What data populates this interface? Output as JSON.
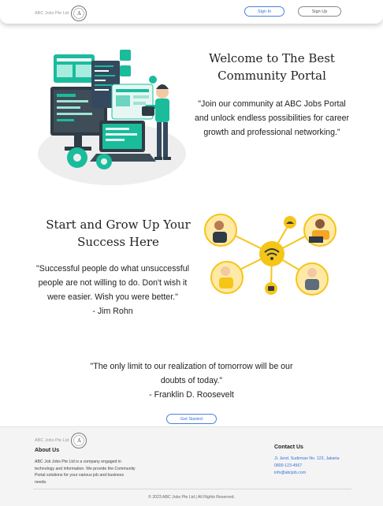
{
  "header": {
    "brand_name": "ABC Jobs Pte Ltd",
    "logo_letter": "A",
    "signin_label": "Sign In",
    "signup_label": "Sign Up"
  },
  "hero": {
    "title": "Welcome to The Best Community Portal",
    "quote": "\"Join our community at ABC Jobs Portal and unlock endless possibilities for career growth and professional networking.\""
  },
  "grow": {
    "title": "Start and Grow Up Your Success Here",
    "quote": "\"Successful people do what unsuccessful people are not willing to do. Don't wish it were easier. Wish you were better.\"",
    "author": "- Jim Rohn"
  },
  "closing": {
    "quote": "\"The only limit to our realization of tomorrow will be our doubts of today.\"",
    "author": "- Franklin D. Roosevelt",
    "cta_label": "Get Started"
  },
  "footer": {
    "brand_name": "ABC Jobs Pte Ltd",
    "logo_letter": "A",
    "about_heading": "About Us",
    "about_text": "ABC Job Jobs Pte Ltd is a company engaged in technology and information. We provide the Community Portal solutions for your various job and business needs.",
    "contact_heading": "Contact Us",
    "address": "Jl. Jend. Sudirman No. 123, Jakarta",
    "phone": "0800-123-4567",
    "email": "info@abcjob.com",
    "copyright": "© 2023 ABC Jobs Pte Ltd | All Rights Reserved."
  },
  "colors": {
    "accent_blue": "#3a6fd6",
    "teal": "#1abc9c",
    "yellow": "#f5c518",
    "footer_bg": "#f4f4f4"
  },
  "icons": {
    "hero_illustration": "developer-workstation-illustration",
    "network_illustration": "connected-people-network-illustration",
    "logo": "company-seal-logo"
  }
}
